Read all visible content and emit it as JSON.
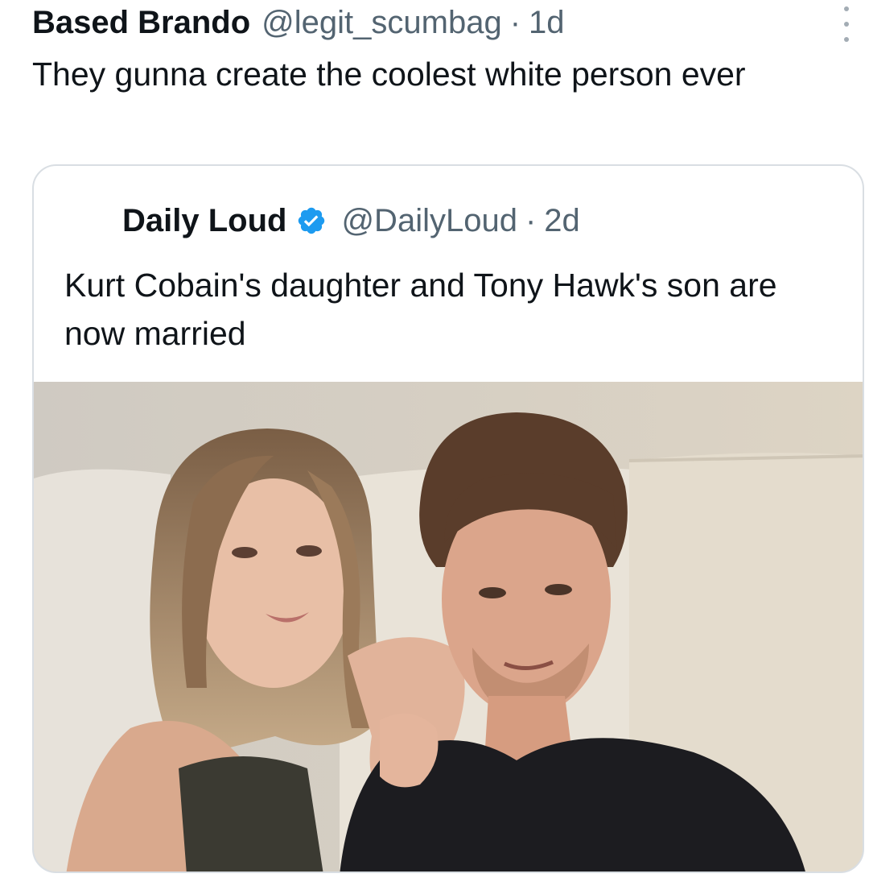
{
  "tweet": {
    "display_name": "Based Brando",
    "handle": "@legit_scumbag",
    "separator": "·",
    "time": "1d",
    "text": "They gunna create the coolest white person ever",
    "more_icon": "more-vertical-icon"
  },
  "quoted_tweet": {
    "display_name": "Daily Loud",
    "verified_icon": "verified-badge-icon",
    "verified_color": "#1d9bf0",
    "handle": "@DailyLoud",
    "separator": "·",
    "time": "2d",
    "text": "Kurt Cobain's daughter and Tony Hawk's son are now married"
  },
  "colors": {
    "text_primary": "#0f1419",
    "text_secondary": "#536471",
    "border": "#d9dee3"
  }
}
